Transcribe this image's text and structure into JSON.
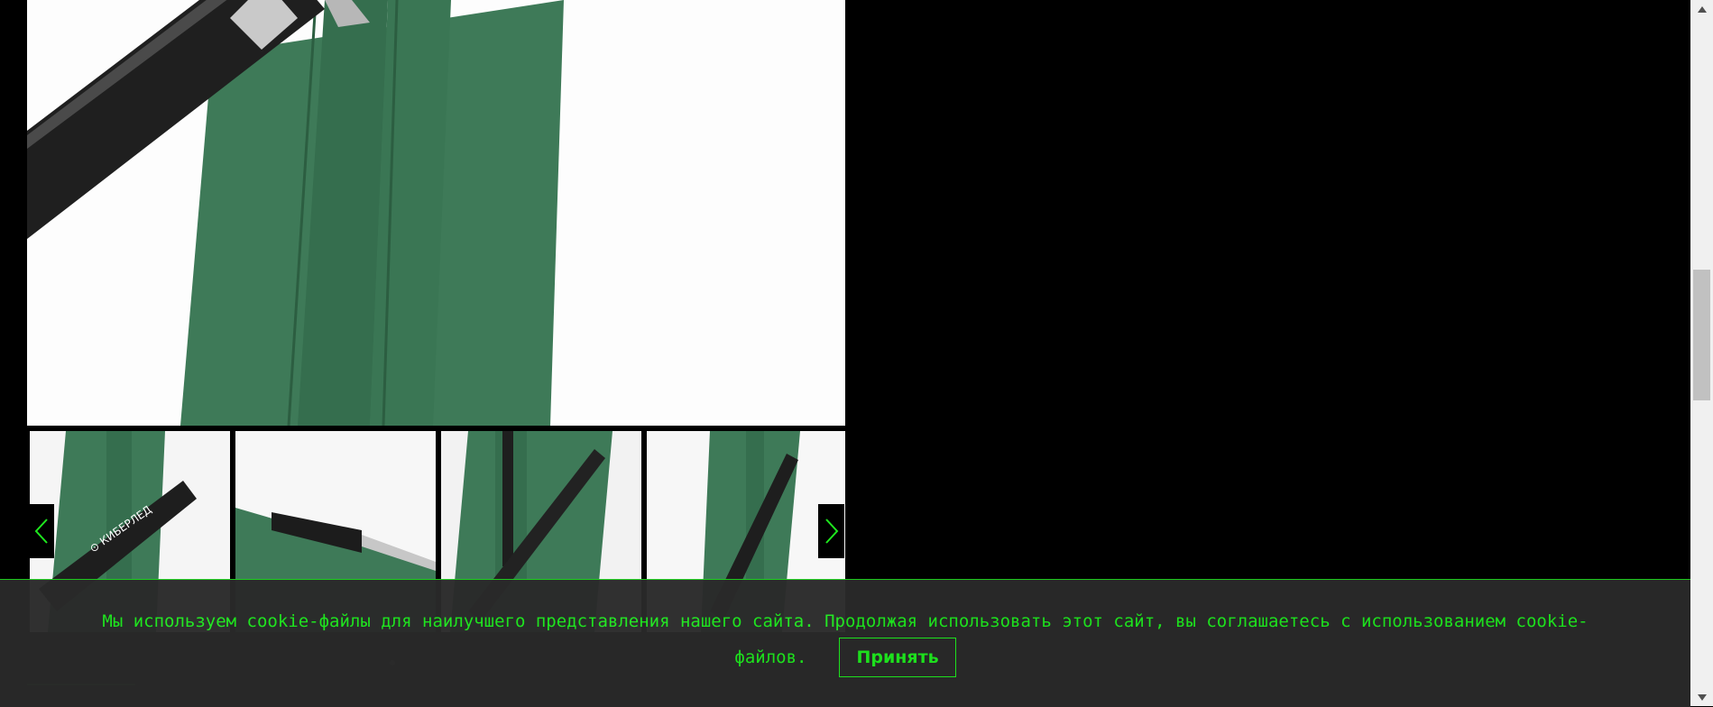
{
  "gallery": {
    "main_image_alt": "pen on green paper sleeve",
    "colors": {
      "sleeve_green": "#3d7a55",
      "pen_black": "#1e1e1e",
      "background_white": "#fdfdfd"
    },
    "thumbnails": [
      {
        "name": "thumb-pen-logo"
      },
      {
        "name": "thumb-pen-inside-sleeve"
      },
      {
        "name": "thumb-pen-on-sleeve"
      },
      {
        "name": "thumb-pen-close-up"
      }
    ],
    "prev_icon": "chevron-left-icon",
    "next_icon": "chevron-right-icon"
  },
  "cookie_banner": {
    "text_line1": "Мы используем cookie-файлы для наилучшего представления нашего сайта. Продолжая использовать этот сайт, вы соглашаетесь с использованием cookie-",
    "text_line2": "файлов.",
    "accept_label": "Принять",
    "accent_color": "#1ee81e"
  },
  "scrollbar": {
    "up_icon": "triangle-up-icon",
    "down_icon": "triangle-down-icon"
  }
}
